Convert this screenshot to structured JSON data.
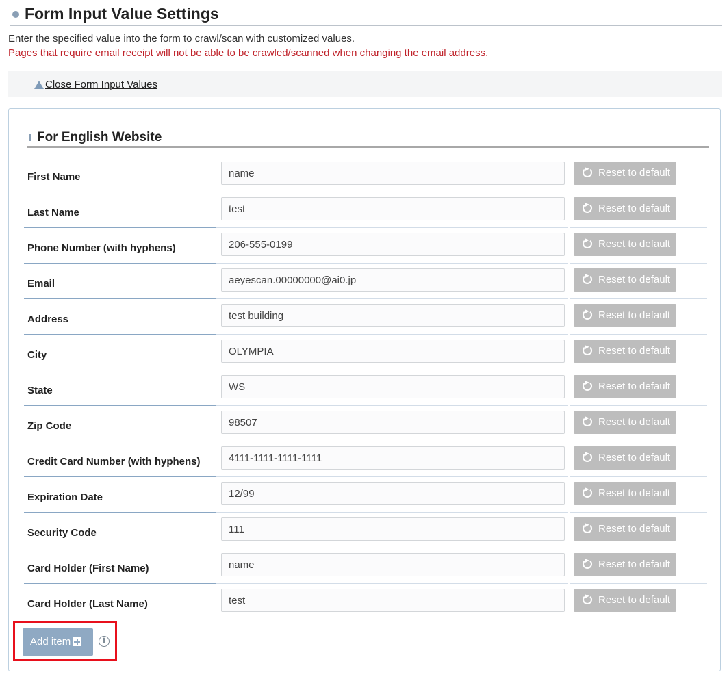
{
  "header": {
    "title": "Form Input Value Settings",
    "description": "Enter the specified value into the form to crawl/scan with customized values.",
    "warning": "Pages that require email receipt will not be able to be crawled/scanned when changing the email address.",
    "toggle_label": "Close Form Input Values"
  },
  "section": {
    "title": "For English Website"
  },
  "reset_label": "Reset to default",
  "rows": [
    {
      "label": "First Name",
      "value": "name"
    },
    {
      "label": "Last Name",
      "value": "test"
    },
    {
      "label": "Phone Number (with hyphens)",
      "value": "206-555-0199"
    },
    {
      "label": "Email",
      "value": "aeyescan.00000000@ai0.jp"
    },
    {
      "label": "Address",
      "value": "test building"
    },
    {
      "label": "City",
      "value": "OLYMPIA"
    },
    {
      "label": "State",
      "value": "WS"
    },
    {
      "label": "Zip Code",
      "value": "98507"
    },
    {
      "label": "Credit Card Number (with hyphens)",
      "value": "4111-1111-1111-1111"
    },
    {
      "label": "Expiration Date",
      "value": "12/99"
    },
    {
      "label": "Security Code",
      "value": "111"
    },
    {
      "label": "Card Holder (First Name)",
      "value": "name"
    },
    {
      "label": "Card Holder (Last Name)",
      "value": "test"
    }
  ],
  "add_item_label": "Add item",
  "info_icon_glyph": "i",
  "colors": {
    "warning": "#c0232b",
    "accent": "#8fa9c3",
    "reset_button": "#bdbdbd",
    "highlight": "#e8101c"
  }
}
